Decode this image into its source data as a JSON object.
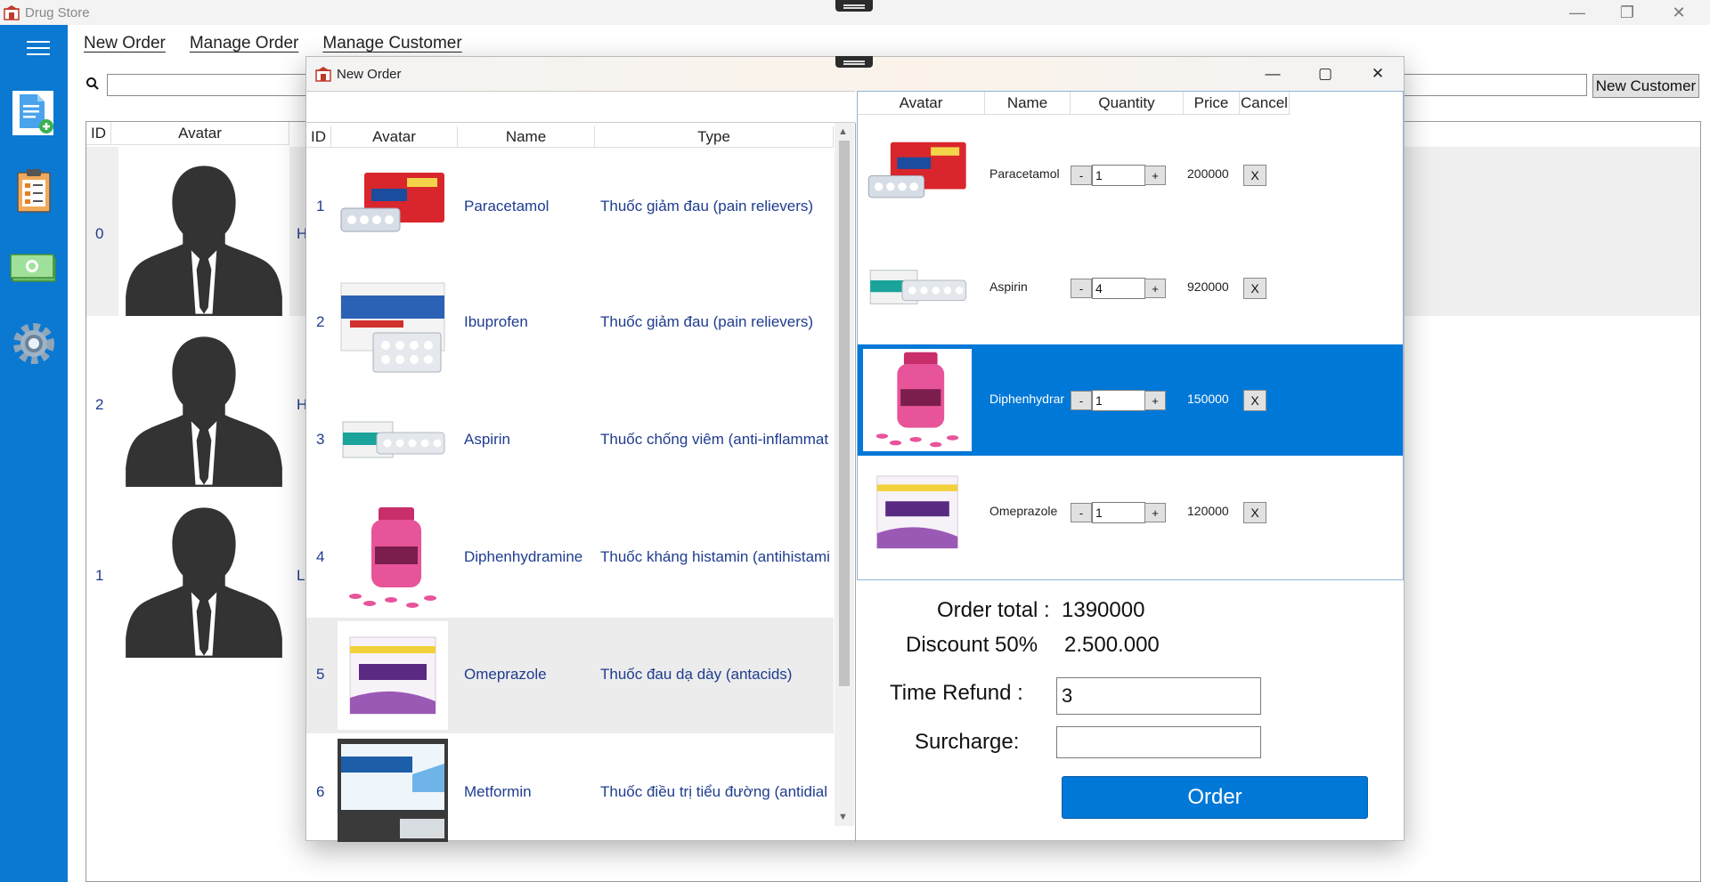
{
  "app": {
    "title": "Drug Store"
  },
  "menu": {
    "items": [
      "New Order",
      "Manage Order",
      "Manage Customer"
    ]
  },
  "search": {
    "placeholder": ""
  },
  "new_customer_button": "New Customer",
  "customer_grid": {
    "columns": [
      "ID",
      "Avatar"
    ],
    "rows": [
      {
        "id": "0",
        "name_fragment": "H"
      },
      {
        "id": "2",
        "name_fragment": "H"
      },
      {
        "id": "1",
        "name_fragment": "L"
      }
    ]
  },
  "dialog": {
    "title": "New Order",
    "drug_grid": {
      "columns": [
        "ID",
        "Avatar",
        "Name",
        "Type"
      ],
      "rows": [
        {
          "id": "1",
          "name": "Paracetamol",
          "type": "Thuốc giảm đau (pain relievers)"
        },
        {
          "id": "2",
          "name": "Ibuprofen",
          "type": "Thuốc giảm đau (pain relievers)"
        },
        {
          "id": "3",
          "name": "Aspirin",
          "type": "Thuốc chống viêm (anti-inflammat"
        },
        {
          "id": "4",
          "name": "Diphenhydramine",
          "type": "Thuốc kháng histamin (antihistami"
        },
        {
          "id": "5",
          "name": "Omeprazole",
          "type": "Thuốc đau dạ dày (antacids)"
        },
        {
          "id": "6",
          "name": "Metformin",
          "type": "Thuốc điều trị tiểu đường (antidial"
        }
      ]
    },
    "cart": {
      "columns": [
        "Avatar",
        "Name",
        "Quantity",
        "Price",
        "Cancel"
      ],
      "minus": "-",
      "plus": "+",
      "cancel": "X",
      "rows": [
        {
          "name": "Paracetamol",
          "quantity": "1",
          "price": "200000"
        },
        {
          "name": "Aspirin",
          "quantity": "4",
          "price": "920000"
        },
        {
          "name": "Diphenhydramine",
          "quantity": "1",
          "price": "150000"
        },
        {
          "name": "Omeprazole",
          "quantity": "1",
          "price": "120000"
        }
      ]
    },
    "summary": {
      "order_total_label": "Order total :",
      "order_total_value": "1390000",
      "discount_label": "Discount 50%",
      "discount_value": "2.500.000",
      "time_refund_label": "Time Refund :",
      "time_refund_value": "3",
      "surcharge_label": "Surcharge:",
      "surcharge_value": ""
    },
    "order_button": "Order"
  },
  "colors": {
    "accent": "#0078d7",
    "sidebar": "#0b78d1",
    "link_text": "#1f3c8f",
    "selection": "#0078d7"
  },
  "icons": [
    "app-logo-icon",
    "hamburger-menu-icon",
    "new-order-icon",
    "manage-order-icon",
    "money-icon",
    "settings-gear-icon",
    "search-icon",
    "minimize-icon",
    "maximize-icon",
    "close-icon"
  ]
}
